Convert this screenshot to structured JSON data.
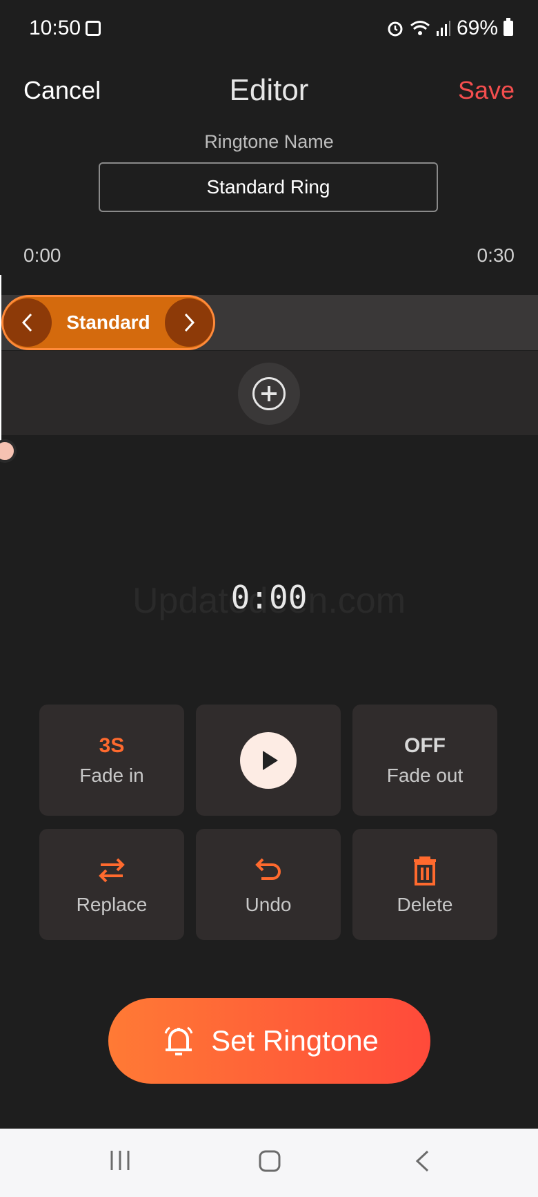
{
  "status_bar": {
    "time": "10:50",
    "battery": "69%"
  },
  "header": {
    "cancel": "Cancel",
    "title": "Editor",
    "save": "Save"
  },
  "ringtone": {
    "label": "Ringtone Name",
    "name": "Standard Ring"
  },
  "timeline": {
    "start": "0:00",
    "end": "0:30",
    "clip_label": "Standard"
  },
  "timer": "0:00",
  "watermark": "Updatedeen.com",
  "controls": {
    "fade_in": {
      "value": "3S",
      "label": "Fade in"
    },
    "fade_out": {
      "value": "OFF",
      "label": "Fade out"
    },
    "replace": {
      "label": "Replace"
    },
    "undo": {
      "label": "Undo"
    },
    "delete": {
      "label": "Delete"
    }
  },
  "set_ringtone": "Set Ringtone",
  "colors": {
    "accent": "#ff6a2e",
    "save": "#f44e4e"
  }
}
